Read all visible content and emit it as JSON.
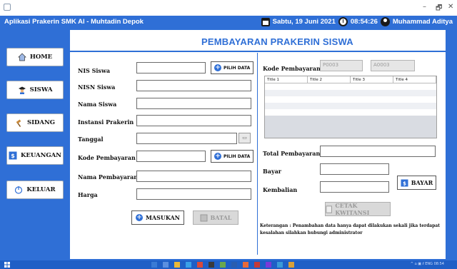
{
  "window": {
    "minimize": "–",
    "maximize": "🗗",
    "close": "✕"
  },
  "header": {
    "app_title": "Aplikasi Prakerin SMK Al - Muhtadin Depok",
    "date": "Sabtu, 19 Juni 2021",
    "time": "08:54:26",
    "user": "Muhammad Aditya"
  },
  "nav": [
    {
      "label": "HOME",
      "icon": "home-icon"
    },
    {
      "label": "SISWA",
      "icon": "student-icon"
    },
    {
      "label": "SIDANG",
      "icon": "gavel-icon"
    },
    {
      "label": "KEUANGAN",
      "icon": "money-icon"
    },
    {
      "label": "KELUAR",
      "icon": "power-icon"
    }
  ],
  "page_title": "PEMBAYARAN PRAKERIN SISWA",
  "form": {
    "nis": "NIS Siswa",
    "nisn": "NISN Siswa",
    "nama": "Nama Siswa",
    "instansi": "Instansi Prakerin",
    "tanggal": "Tanggal",
    "kode": "Kode Pembayaran",
    "nama_pembayaran": "Nama Pembayaran",
    "harga": "Harga",
    "pilih_data": "PILIH DATA",
    "calendar_glyph": "▭"
  },
  "right": {
    "kode_label": "Kode Pembayaran",
    "kode1": "P0003",
    "kode2": "A0003",
    "columns": [
      "Title 1",
      "Title 2",
      "Title 3",
      "Title 4"
    ],
    "total_label": "Total Pembayaran",
    "bayar_label": "Bayar",
    "kembalian_label": "Kembalian"
  },
  "buttons": {
    "masukan": "MASUKAN",
    "batal": "BATAL",
    "bayar": "BAYAR",
    "cetak": "CETAK KWITANSI"
  },
  "note": "Keterangan : Penambahan data hanya dapat dilakukan sekali jika terdapat kesalahan silahkan hubungi administrator",
  "tray": "^ ⌂ ▣ ℓ ENG 08:54",
  "colors": {
    "accent": "#2f6fd6",
    "taskbar": "#1f5fc6"
  }
}
